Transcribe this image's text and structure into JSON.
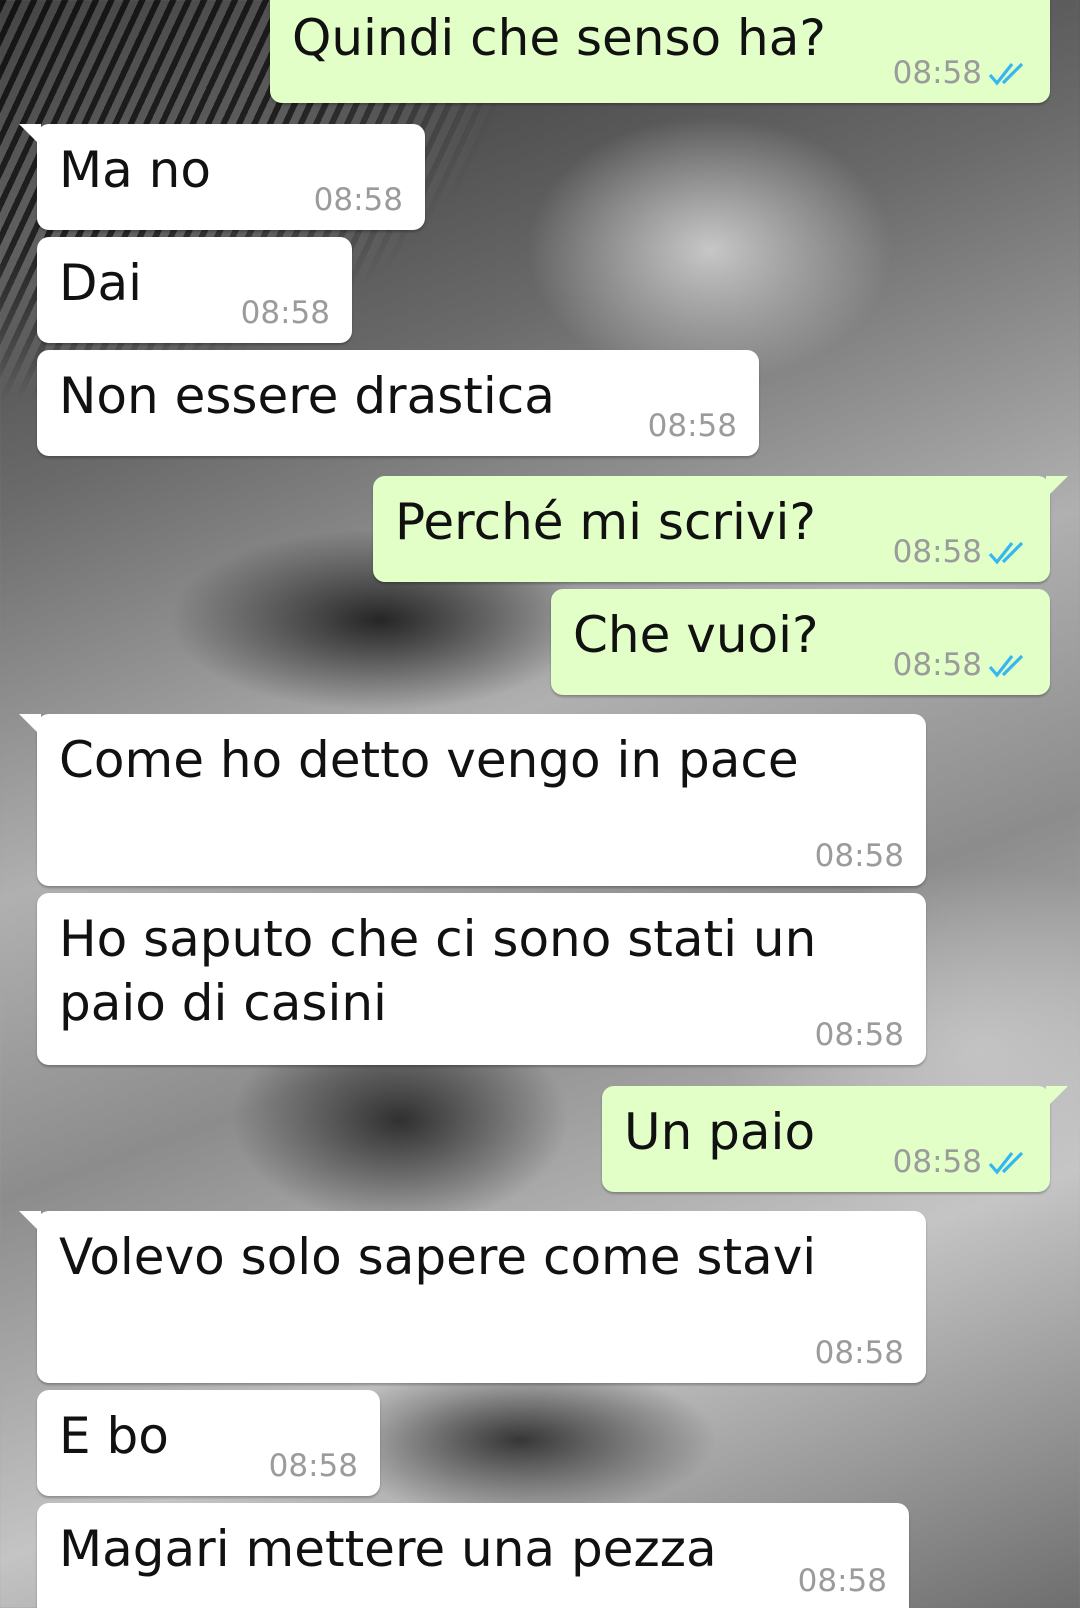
{
  "conversation": {
    "colors": {
      "incoming_bubble": "#ffffff",
      "outgoing_bubble": "#e1ffc7",
      "timestamp": "#9b9b9b",
      "read_ticks": "#34b7f1"
    },
    "messages": [
      {
        "direction": "out",
        "text": "Quindi che senso ha?",
        "time": "08:58",
        "status_icon": "double-check-read-icon"
      },
      {
        "direction": "in",
        "text": "Ma no",
        "time": "08:58"
      },
      {
        "direction": "in",
        "text": "Dai",
        "time": "08:58"
      },
      {
        "direction": "in",
        "text": "Non essere drastica",
        "time": "08:58"
      },
      {
        "direction": "out",
        "text": "Perché mi scrivi?",
        "time": "08:58",
        "status_icon": "double-check-read-icon"
      },
      {
        "direction": "out",
        "text": "Che vuoi?",
        "time": "08:58",
        "status_icon": "double-check-read-icon"
      },
      {
        "direction": "in",
        "text": "Come ho detto vengo in pace",
        "time": "08:58"
      },
      {
        "direction": "in",
        "text_lines": [
          "Ho saputo che ci sono stati un",
          "paio di casini"
        ],
        "time": "08:58"
      },
      {
        "direction": "out",
        "text": "Un paio",
        "time": "08:58",
        "status_icon": "double-check-read-icon"
      },
      {
        "direction": "in",
        "text": "Volevo solo sapere come stavi",
        "time": "08:58"
      },
      {
        "direction": "in",
        "text": "E bo",
        "time": "08:58"
      },
      {
        "direction": "in",
        "text": "Magari mettere una pezza",
        "time": "08:58"
      }
    ]
  }
}
